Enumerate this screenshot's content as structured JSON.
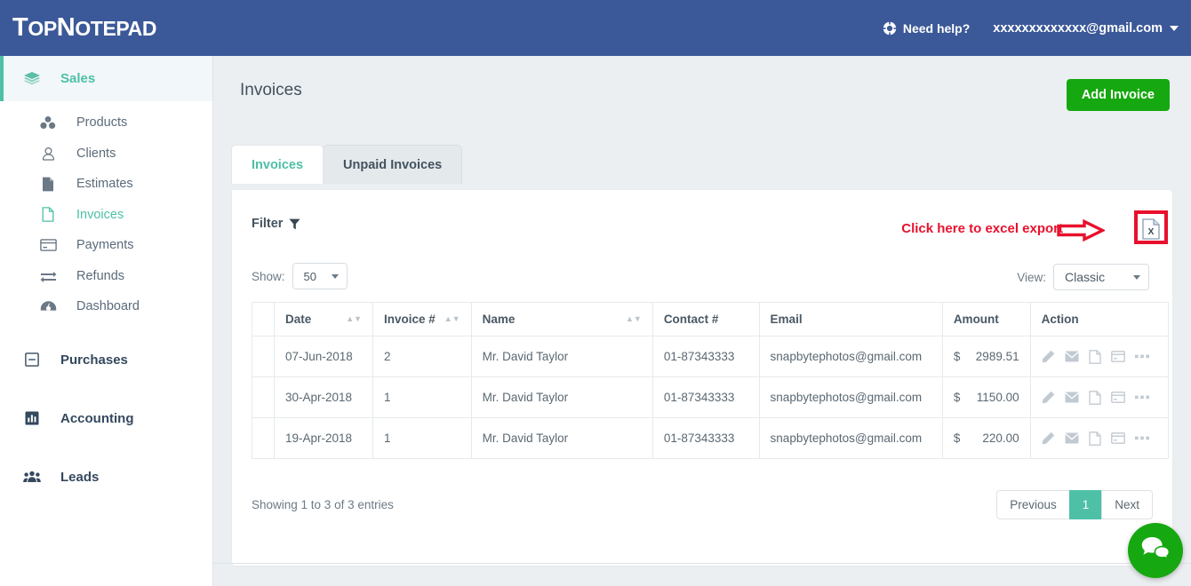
{
  "header": {
    "logo_cap": "T",
    "logo_rest1": "OP",
    "logo_cap2": "N",
    "logo_rest2": "OTEPAD",
    "need_help": "Need help?",
    "user_email": "xxxxxxxxxxxxx@gmail.com",
    "brand_color": "#3b5998"
  },
  "sidebar": {
    "groups": [
      {
        "label": "Sales",
        "icon": "layers-icon",
        "active": true,
        "items": [
          {
            "label": "Products",
            "icon": "products-icon",
            "current": false
          },
          {
            "label": "Clients",
            "icon": "user-icon",
            "current": false
          },
          {
            "label": "Estimates",
            "icon": "document-icon",
            "current": false
          },
          {
            "label": "Invoices",
            "icon": "invoice-icon",
            "current": true
          },
          {
            "label": "Payments",
            "icon": "card-icon",
            "current": false
          },
          {
            "label": "Refunds",
            "icon": "exchange-icon",
            "current": false
          },
          {
            "label": "Dashboard",
            "icon": "dashboard-icon",
            "current": false
          }
        ]
      },
      {
        "label": "Purchases",
        "icon": "minus-square-icon",
        "active": false,
        "items": []
      },
      {
        "label": "Accounting",
        "icon": "bar-chart-icon",
        "active": false,
        "items": []
      },
      {
        "label": "Leads",
        "icon": "users-icon",
        "active": false,
        "items": []
      }
    ],
    "accent_color": "#4ec0a6"
  },
  "main": {
    "page_title": "Invoices",
    "add_button": "Add Invoice",
    "add_button_color": "#16a810",
    "tabs": [
      {
        "label": "Invoices",
        "active": true
      },
      {
        "label": "Unpaid Invoices",
        "active": false
      }
    ],
    "filter_label": "Filter",
    "show_label": "Show:",
    "show_value": "50",
    "view_label": "View:",
    "view_value": "Classic",
    "annotation": {
      "text": "Click here to  excel export",
      "color": "#e8112d",
      "arrow": "right-arrow-icon",
      "target_icon": "excel-export-icon"
    },
    "table": {
      "columns": [
        {
          "label": "",
          "sortable": false
        },
        {
          "label": "Date",
          "sortable": true
        },
        {
          "label": "Invoice #",
          "sortable": true
        },
        {
          "label": "Name",
          "sortable": true
        },
        {
          "label": "Contact #",
          "sortable": false
        },
        {
          "label": "Email",
          "sortable": false
        },
        {
          "label": "Amount",
          "sortable": false
        },
        {
          "label": "Action",
          "sortable": false
        }
      ],
      "rows": [
        {
          "date": "07-Jun-2018",
          "invoice_no": "2",
          "name": "Mr. David Taylor",
          "contact": "01-87343333",
          "email": "snapbytephotos@gmail.com",
          "currency": "$",
          "amount": "2989.51"
        },
        {
          "date": "30-Apr-2018",
          "invoice_no": "1",
          "name": "Mr. David Taylor",
          "contact": "01-87343333",
          "email": "snapbytephotos@gmail.com",
          "currency": "$",
          "amount": "1150.00"
        },
        {
          "date": "19-Apr-2018",
          "invoice_no": "1",
          "name": "Mr. David Taylor",
          "contact": "01-87343333",
          "email": "snapbytephotos@gmail.com",
          "currency": "$",
          "amount": "220.00"
        }
      ],
      "row_action_icons": [
        "edit-pencil-icon",
        "envelope-icon",
        "pdf-icon",
        "credit-card-icon",
        "more-ellipsis-icon"
      ]
    },
    "entries_text": "Showing 1 to 3 of 3 entries",
    "pagination": {
      "previous": "Previous",
      "pages": [
        "1"
      ],
      "next": "Next",
      "active_page": "1",
      "active_color": "#4ec0a6"
    }
  },
  "chat": {
    "icon": "chat-bubbles-icon",
    "color": "#16a810"
  }
}
